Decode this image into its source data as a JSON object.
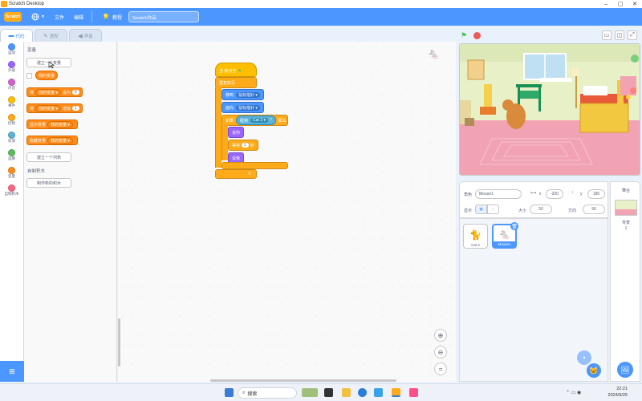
{
  "window": {
    "title": "Scratch Desktop"
  },
  "menubar": {
    "logo": "Scratch",
    "file": "文件",
    "edit": "编辑",
    "tutorials": "教程",
    "project_title": "Scratch作品"
  },
  "tabs": [
    "代码",
    "造型",
    "声音"
  ],
  "categories": [
    {
      "label": "运动",
      "color": "#4c97ff"
    },
    {
      "label": "外观",
      "color": "#9966ff"
    },
    {
      "label": "声音",
      "color": "#cf63cf"
    },
    {
      "label": "事件",
      "color": "#ffbf00"
    },
    {
      "label": "控制",
      "color": "#ffab19"
    },
    {
      "label": "侦测",
      "color": "#5cb1d6"
    },
    {
      "label": "运算",
      "color": "#59c059"
    },
    {
      "label": "变量",
      "color": "#ff8c1a"
    },
    {
      "label": "自制积木",
      "color": "#ff6680"
    }
  ],
  "palette": {
    "variables_heading": "变量",
    "make_variable": "建立一个变量",
    "my_variable": "我的变量",
    "set_block": {
      "prefix": "将",
      "var": "我的变量",
      "mid": "设为",
      "value": "0"
    },
    "change_block": {
      "prefix": "将",
      "var": "我的变量",
      "mid": "增加",
      "value": "1"
    },
    "show_block": {
      "prefix": "显示变量",
      "var": "我的变量"
    },
    "hide_block": {
      "prefix": "隐藏变量",
      "var": "我的变量"
    },
    "make_list": "建立一个列表",
    "my_blocks_heading": "自制积木",
    "make_block": "制作新的积木"
  },
  "script": {
    "hat": "当 被点击",
    "forever": "重复执行",
    "goto": "移到",
    "goto_target": "鼠标指针",
    "face": "面向",
    "face_target": "鼠标指针",
    "if": "如果",
    "touching": "碰到",
    "touching_target": "Cat 2",
    "then": "那么",
    "say_a": "说你",
    "wait": "等待",
    "wait_value": "1",
    "wait_unit": "秒",
    "say_b": "说我"
  },
  "sprite_info": {
    "sprite_label": "角色",
    "sprite_name": "Mouse1",
    "x_label": "x",
    "x_value": "-200",
    "y_label": "y",
    "y_value": "180",
    "show_label": "显示",
    "size_label": "大小",
    "size_value": "50",
    "direction_label": "方向",
    "direction_value": "90"
  },
  "sprites": [
    {
      "name": "Cat 2",
      "selected": false
    },
    {
      "name": "Mouse1",
      "selected": true
    }
  ],
  "stage_panel": {
    "title": "舞台",
    "backdrop_label": "背景",
    "backdrop_count": "1"
  },
  "taskbar": {
    "search": "搜索",
    "time": "22:21",
    "date": "2024/9/25"
  }
}
